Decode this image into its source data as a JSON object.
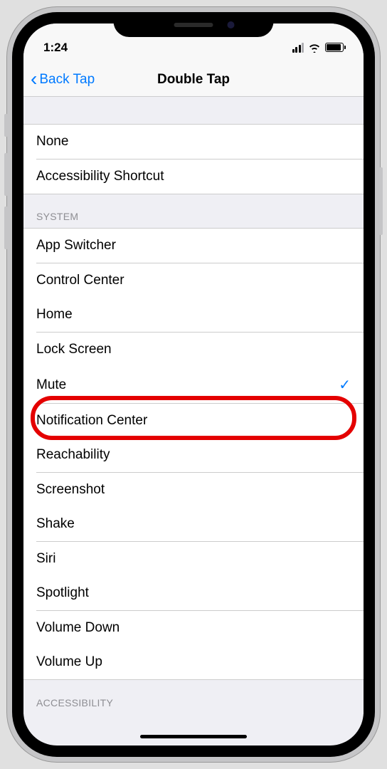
{
  "status": {
    "time": "1:24"
  },
  "nav": {
    "back_label": "Back Tap",
    "title": "Double Tap"
  },
  "sections": {
    "top": {
      "items": [
        {
          "label": "None",
          "selected": false
        },
        {
          "label": "Accessibility Shortcut",
          "selected": false
        }
      ]
    },
    "system": {
      "header": "SYSTEM",
      "items": [
        {
          "label": "App Switcher",
          "selected": false
        },
        {
          "label": "Control Center",
          "selected": false
        },
        {
          "label": "Home",
          "selected": false
        },
        {
          "label": "Lock Screen",
          "selected": false
        },
        {
          "label": "Mute",
          "selected": true
        },
        {
          "label": "Notification Center",
          "selected": false
        },
        {
          "label": "Reachability",
          "selected": false
        },
        {
          "label": "Screenshot",
          "selected": false
        },
        {
          "label": "Shake",
          "selected": false
        },
        {
          "label": "Siri",
          "selected": false
        },
        {
          "label": "Spotlight",
          "selected": false
        },
        {
          "label": "Volume Down",
          "selected": false
        },
        {
          "label": "Volume Up",
          "selected": false
        }
      ]
    },
    "accessibility": {
      "header": "ACCESSIBILITY"
    }
  },
  "highlighted_item": "Mute"
}
